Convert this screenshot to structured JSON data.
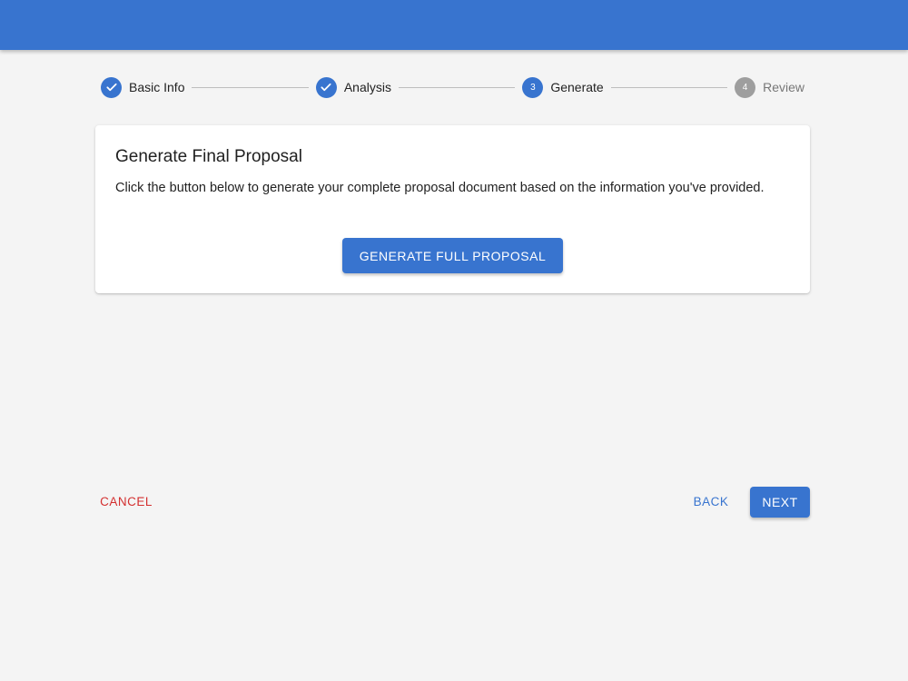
{
  "colors": {
    "primary": "#3874cf",
    "danger": "#d32f2f",
    "pending": "#9e9e9e",
    "background": "#f4f4f4"
  },
  "stepper": {
    "steps": [
      {
        "label": "Basic Info",
        "state": "completed",
        "icon": "check-icon"
      },
      {
        "label": "Analysis",
        "state": "completed",
        "icon": "check-icon"
      },
      {
        "label": "Generate",
        "state": "active",
        "number": "3"
      },
      {
        "label": "Review",
        "state": "pending",
        "number": "4"
      }
    ]
  },
  "card": {
    "title": "Generate Final Proposal",
    "text": "Click the button below to generate your complete proposal document based on the information you've provided.",
    "button_label": "GENERATE FULL PROPOSAL"
  },
  "footer": {
    "cancel_label": "CANCEL",
    "back_label": "BACK",
    "next_label": "NEXT"
  }
}
